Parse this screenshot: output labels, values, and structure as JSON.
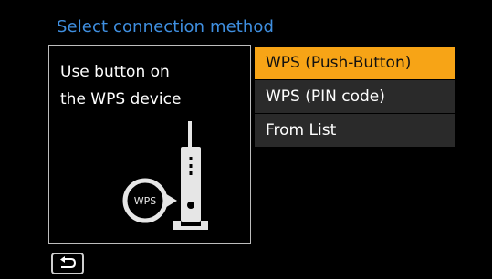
{
  "header": {
    "title": "Select connection method"
  },
  "info": {
    "line1": "Use button on",
    "line2": "the WPS device",
    "illustration_label": "WPS"
  },
  "menu": {
    "items": [
      {
        "label": "WPS (Push-Button)",
        "selected": true
      },
      {
        "label": "WPS (PIN code)",
        "selected": false
      },
      {
        "label": "From List",
        "selected": false
      }
    ]
  },
  "footer": {
    "back_icon": "return-arrow-icon"
  },
  "colors": {
    "title": "#3f8fe0",
    "selected_item": "#f7a416",
    "item_background": "#2a2a2a",
    "background": "#000000"
  }
}
